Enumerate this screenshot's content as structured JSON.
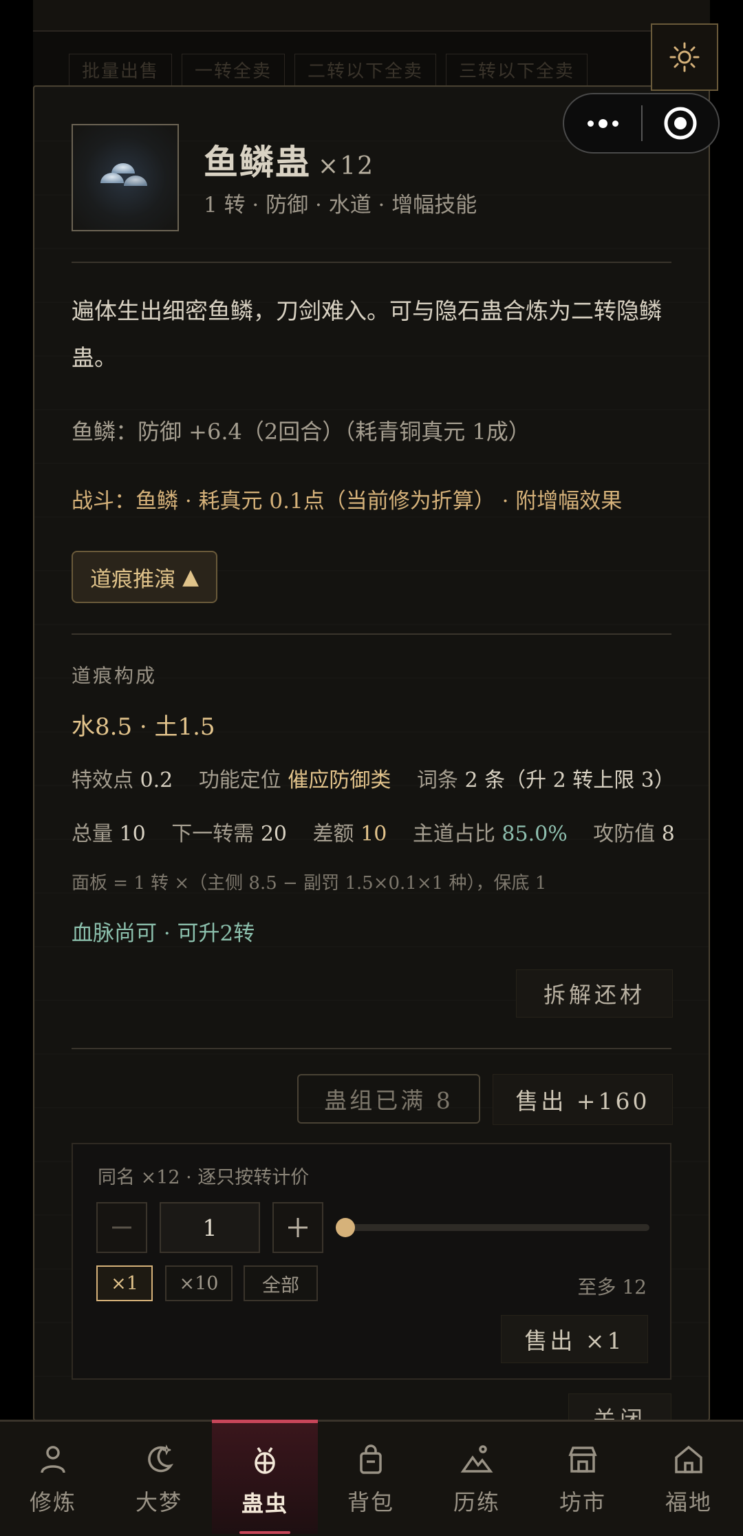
{
  "background_tabs": [
    "批量出售",
    "一转全卖",
    "二转以下全卖",
    "三转以下全卖"
  ],
  "item": {
    "name": "鱼鳞蛊",
    "count_label": "×12",
    "subtitle": "1 转 · 防御 · 水道 · 增幅技能",
    "description": "遍体生出细密鱼鳞，刀剑难入。可与隐石蛊合炼为二转隐鳞蛊。",
    "effect": "鱼鳞：防御 +6.4（2回合）（耗青铜真元 1成）",
    "battle": "战斗：鱼鳞 · 耗真元 0.1点（当前修为折算） · 附增幅效果"
  },
  "toggle_label": "道痕推演",
  "toggle_arrow": "▲",
  "dao_section": {
    "label": "道痕构成",
    "elements": "水8.5 · 土1.5",
    "row1": {
      "effect_points_label": "特效点",
      "effect_points": "0.2",
      "role_label": "功能定位",
      "role": "催应防御类",
      "entries_label": "词条",
      "entries": "2 条（升 2 转上限 3）"
    },
    "row2": {
      "total_label": "总量",
      "total": "10",
      "next_label": "下一转需",
      "next": "20",
      "diff_label": "差额",
      "diff": "10",
      "main_ratio_label": "主道占比",
      "main_ratio": "85.0%",
      "atkdef_label": "攻防值",
      "atkdef": "8"
    },
    "formula": "面板 = 1 转 ×（主侧 8.5 − 副罚 1.5×0.1×1 种），保底 1",
    "bloodline": "血脉尚可 · 可升2转"
  },
  "dismantle_label": "拆解还材",
  "group_full_label": "蛊组已满 8",
  "sell_top_label": "售出 +160",
  "sell_box": {
    "hint": "同名 ×12 · 逐只按转计价",
    "quantity": "1",
    "chips": [
      "×1",
      "×10",
      "全部"
    ],
    "max_label": "至多 12",
    "sell_label": "售出 ×1",
    "slider_fraction": 0
  },
  "close_label": "关闭",
  "tabs": [
    {
      "label": "修炼",
      "icon": "person-icon"
    },
    {
      "label": "大梦",
      "icon": "moon-icon"
    },
    {
      "label": "蛊虫",
      "icon": "bug-icon",
      "active": true
    },
    {
      "label": "背包",
      "icon": "bag-icon"
    },
    {
      "label": "历练",
      "icon": "mountain-icon"
    },
    {
      "label": "坊市",
      "icon": "shop-icon"
    },
    {
      "label": "福地",
      "icon": "home-icon"
    }
  ],
  "colors": {
    "accent_gold": "#d6b27a",
    "accent_teal": "#8fc0b0",
    "active_tab": "#c8465a"
  }
}
